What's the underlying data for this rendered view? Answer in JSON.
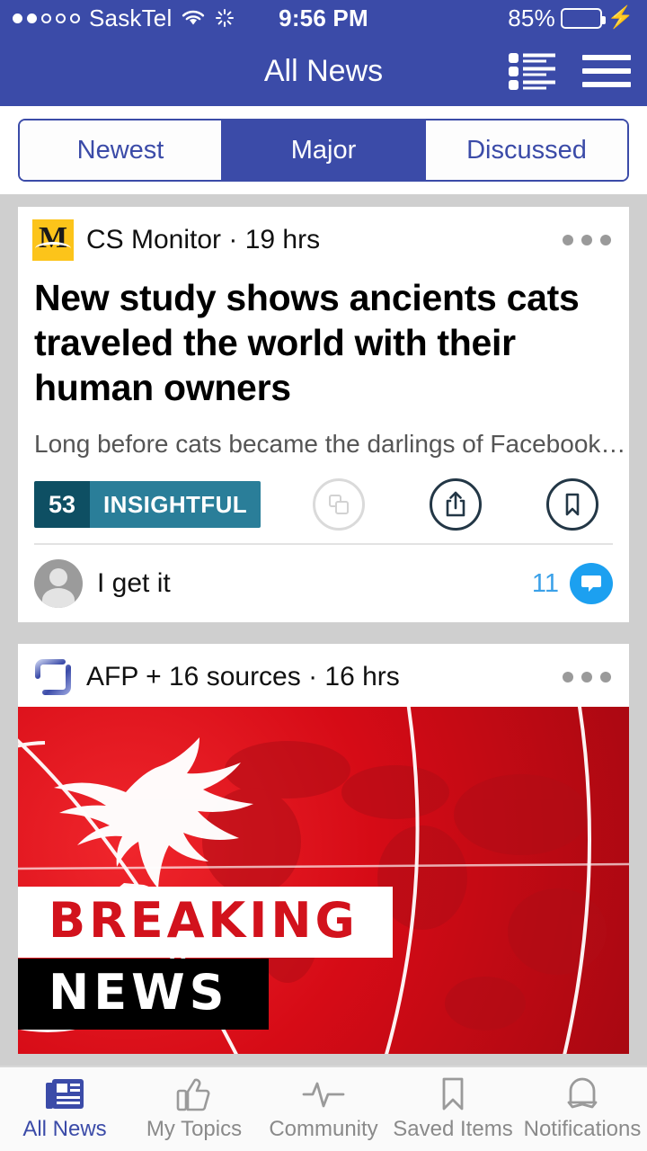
{
  "status_bar": {
    "signal_dots_filled": 2,
    "signal_dots_total": 5,
    "carrier": "SaskTel",
    "wifi_icon": "wifi-icon",
    "activity_icon": "activity-spinner-icon",
    "time": "9:56 PM",
    "battery_percent": "85%",
    "battery_level": 85,
    "charging_icon": "lightning-bolt-icon"
  },
  "nav": {
    "title": "All News",
    "list_view_icon": "list-view-icon",
    "menu_icon": "hamburger-menu-icon"
  },
  "segmented": {
    "options": [
      {
        "label": "Newest",
        "active": false
      },
      {
        "label": "Major",
        "active": true
      },
      {
        "label": "Discussed",
        "active": false
      }
    ]
  },
  "cards": [
    {
      "source_logo": "cs-monitor-logo",
      "source": "CS Monitor · 19 hrs",
      "more_icon": "kebab-menu-icon",
      "headline": "New study shows ancients cats traveled the world with their human owners",
      "summary": "Long before cats became the darlings of Facebook…",
      "badge": {
        "count": "53",
        "label": "INSIGHTFUL"
      },
      "action_icons": [
        "copies-stack-icon",
        "share-icon",
        "bookmark-icon"
      ],
      "comment": {
        "avatar_icon": "user-avatar-icon",
        "text": "I get it",
        "count": "11",
        "bubble_icon": "comment-bubble-icon"
      }
    },
    {
      "source_logo": "afp-bracket-logo",
      "source": "AFP + 16 sources · 16 hrs",
      "more_icon": "kebab-menu-icon",
      "hero": {
        "breaking_text": "BREAKING",
        "news_text": "NEWS",
        "eagle_icon": "eagle-emblem-icon"
      }
    }
  ],
  "tabbar": {
    "tabs": [
      {
        "label": "All News",
        "icon": "newspaper-icon",
        "active": true
      },
      {
        "label": "My Topics",
        "icon": "thumbs-up-icon",
        "active": false
      },
      {
        "label": "Community",
        "icon": "pulse-activity-icon",
        "active": false
      },
      {
        "label": "Saved Items",
        "icon": "bookmark-icon",
        "active": false
      },
      {
        "label": "Notifications",
        "icon": "bell-icon",
        "active": false
      }
    ]
  },
  "colors": {
    "brand_blue": "#3b4ba8",
    "badge_dark": "#0e4f63",
    "badge_light": "#2a7e99",
    "comment_blue": "#1ca0f0",
    "page_bg": "#cfcfcf",
    "breaking_red": "#d2121c",
    "logo_yellow": "#fcc41a"
  }
}
